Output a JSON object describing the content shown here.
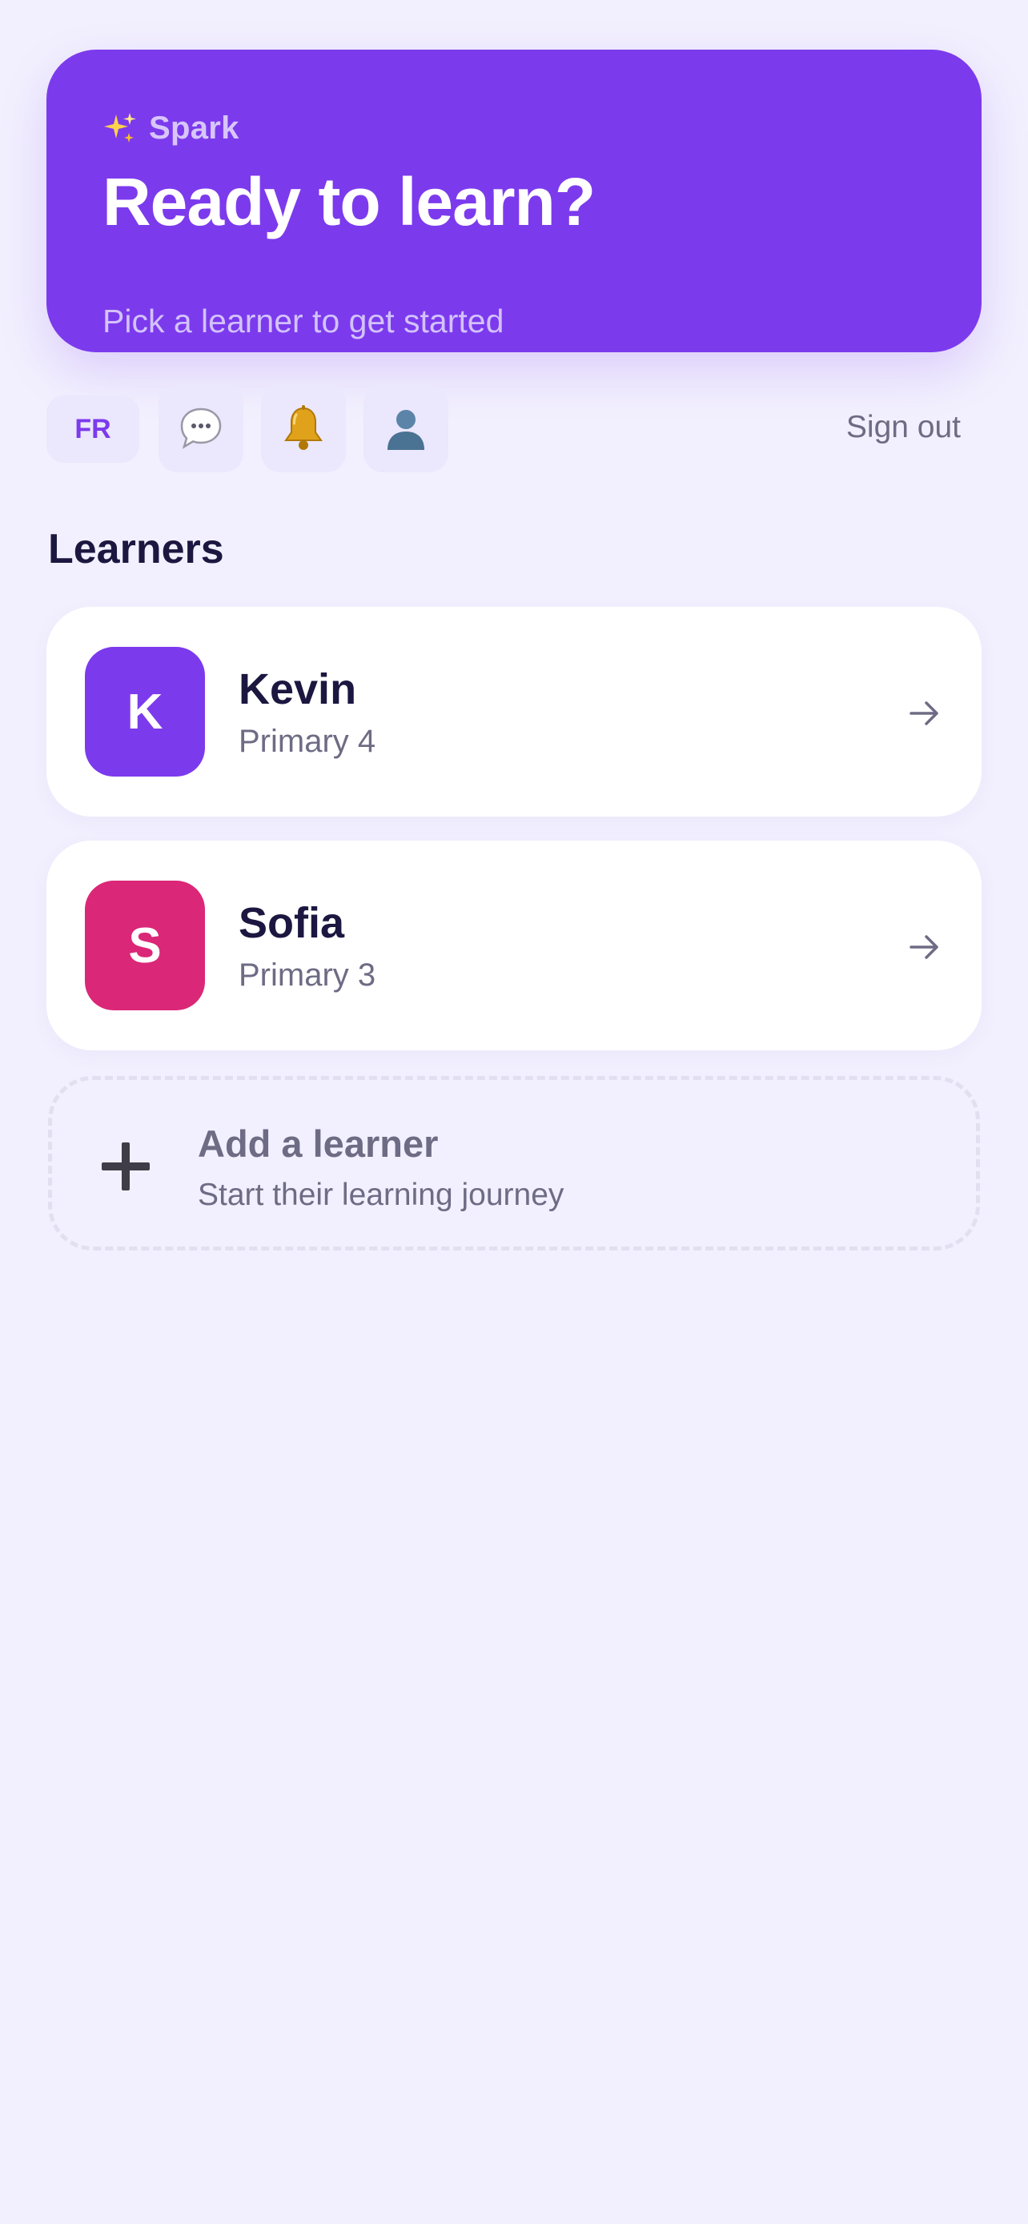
{
  "hero": {
    "brand": "Spark",
    "brand_icon": "sparkles-icon",
    "title": "Ready to learn?",
    "subtitle": "Pick a learner to get started"
  },
  "toolbar": {
    "language": "FR",
    "chat_icon": "chat-bubble-icon",
    "notifications_icon": "bell-icon",
    "profile_icon": "profile-icon",
    "sign_out": "Sign out"
  },
  "learners": {
    "section_title": "Learners",
    "items": [
      {
        "initial": "K",
        "name": "Kevin",
        "grade": "Primary 4",
        "color": "#7c3aed"
      },
      {
        "initial": "S",
        "name": "Sofia",
        "grade": "Primary 3",
        "color": "#db2777"
      }
    ],
    "add": {
      "title": "Add a learner",
      "subtitle": "Start their learning journey"
    }
  },
  "colors": {
    "accent": "#7c3aed",
    "background": "#f2f0fe",
    "text": "#1b1740",
    "muted": "#6e6b84"
  }
}
